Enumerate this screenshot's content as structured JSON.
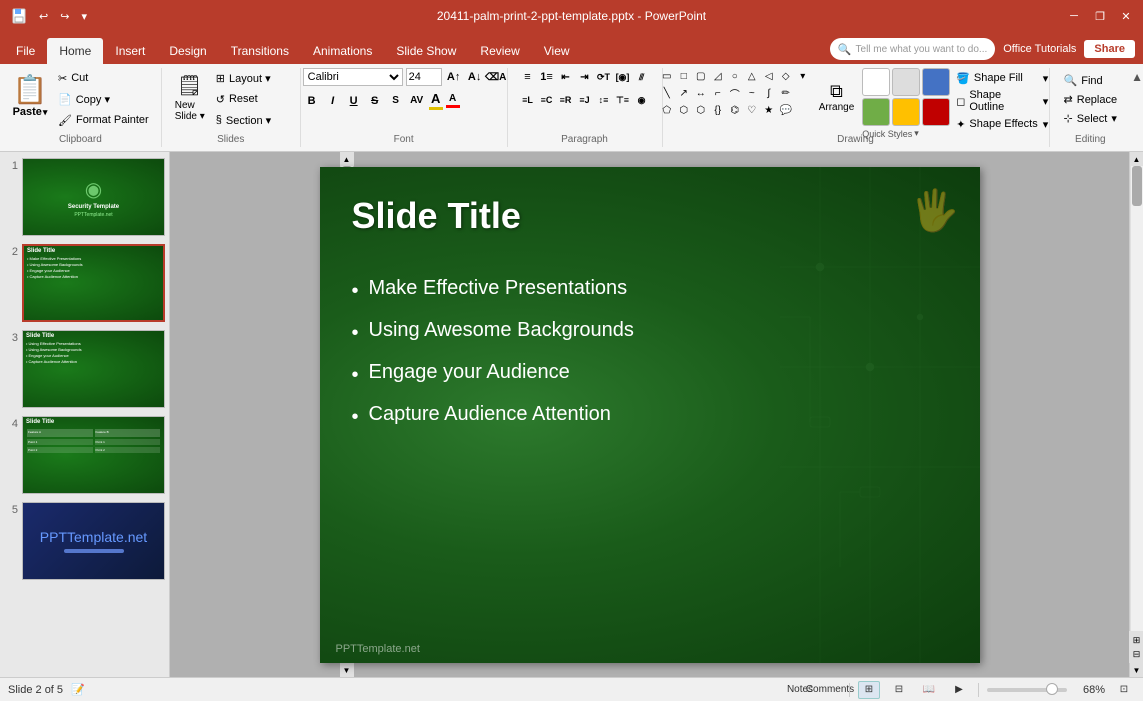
{
  "titlebar": {
    "title": "20411-palm-print-2-ppt-template.pptx - PowerPoint",
    "qat": [
      "save",
      "undo",
      "redo",
      "customize"
    ],
    "winbtns": [
      "minimize",
      "restore",
      "close"
    ]
  },
  "ribbon": {
    "tabs": [
      "File",
      "Home",
      "Insert",
      "Design",
      "Transitions",
      "Animations",
      "Slide Show",
      "Review",
      "View"
    ],
    "active_tab": "Home",
    "help_placeholder": "Tell me what you want to do...",
    "office_tutorials": "Office Tutorials",
    "share": "Share",
    "groups": {
      "clipboard": "Clipboard",
      "slides": "Slides",
      "font": "Font",
      "paragraph": "Paragraph",
      "drawing": "Drawing",
      "editing": "Editing"
    },
    "buttons": {
      "paste": "Paste",
      "new_slide": "New\nSlide",
      "layout": "Layout",
      "reset": "Reset",
      "section": "Section",
      "find": "Find",
      "replace": "Replace",
      "select": "Select"
    },
    "shape_fill": "Shape Fill",
    "shape_outline": "Shape Outline",
    "shape_effects": "Shape Effects",
    "quick_styles": "Quick Styles",
    "arrange": "Arrange",
    "select_label": "Select"
  },
  "slide_panel": {
    "slides": [
      {
        "num": 1,
        "type": "title"
      },
      {
        "num": 2,
        "type": "content",
        "active": true
      },
      {
        "num": 3,
        "type": "content"
      },
      {
        "num": 4,
        "type": "table"
      },
      {
        "num": 5,
        "type": "blue"
      }
    ]
  },
  "slide": {
    "title": "Slide Title",
    "bullets": [
      "Make Effective Presentations",
      "Using Awesome Backgrounds",
      "Engage your Audience",
      "Capture Audience Attention"
    ],
    "watermark": "PPTTemplate.net"
  },
  "statusbar": {
    "slide_info": "Slide 2 of 5",
    "notes": "Notes",
    "comments": "Comments",
    "zoom": "68%",
    "zoom_value": 68
  }
}
